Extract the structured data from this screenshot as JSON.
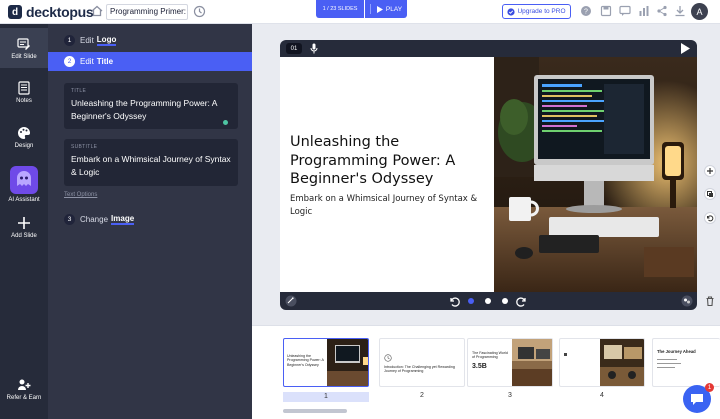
{
  "app": {
    "logo_text": "decktopus",
    "presentation_title": "Programming Primer: A",
    "slides_counter": "1 / 23 SLIDES",
    "play_label": "PLAY",
    "upgrade_label": "Upgrade to PRO",
    "avatar_initial": "A"
  },
  "nav": {
    "edit_slide": "Edit Slide",
    "notes": "Notes",
    "design": "Design",
    "ai_assistant": "AI Assistant",
    "add_slide": "Add Slide",
    "refer_earn": "Refer & Earn"
  },
  "panel": {
    "steps": [
      {
        "num": "1",
        "verb": "Edit",
        "key": "Logo"
      },
      {
        "num": "2",
        "verb": "Edit",
        "key": "Title"
      },
      {
        "num": "3",
        "verb": "Change",
        "key": "Image"
      }
    ],
    "title_field": {
      "label": "TITLE",
      "value": "Unleashing the Programming Power: A Beginner's Odyssey"
    },
    "subtitle_field": {
      "label": "SUBTITLE",
      "value": "Embark on a Whimsical Journey of Syntax & Logic"
    },
    "text_options": "Text Options"
  },
  "editor": {
    "slide_number": "01",
    "slide_title": "Unleashing the Programming Power: A Beginner's Odyssey",
    "slide_subtitle": "Embark on a Whimsical Journey of Syntax & Logic"
  },
  "thumbnails": [
    {
      "label": "1",
      "title": "Unleashing the Programming Power: A Beginner's Odyssey"
    },
    {
      "label": "2",
      "title": "Introduction: The Challenging yet Rewarding Journey of Programming"
    },
    {
      "label": "3",
      "title": "The Fascinating World of Programming",
      "stat": "3.5B"
    },
    {
      "label": "4",
      "title": ""
    },
    {
      "label": "",
      "title": "The Journey Ahead"
    }
  ],
  "chat": {
    "badge": "1"
  },
  "colors": {
    "accent": "#4a5ff4",
    "sidebar": "#262b3a",
    "panel": "#313546",
    "ai_purple": "#6f4ae8"
  }
}
